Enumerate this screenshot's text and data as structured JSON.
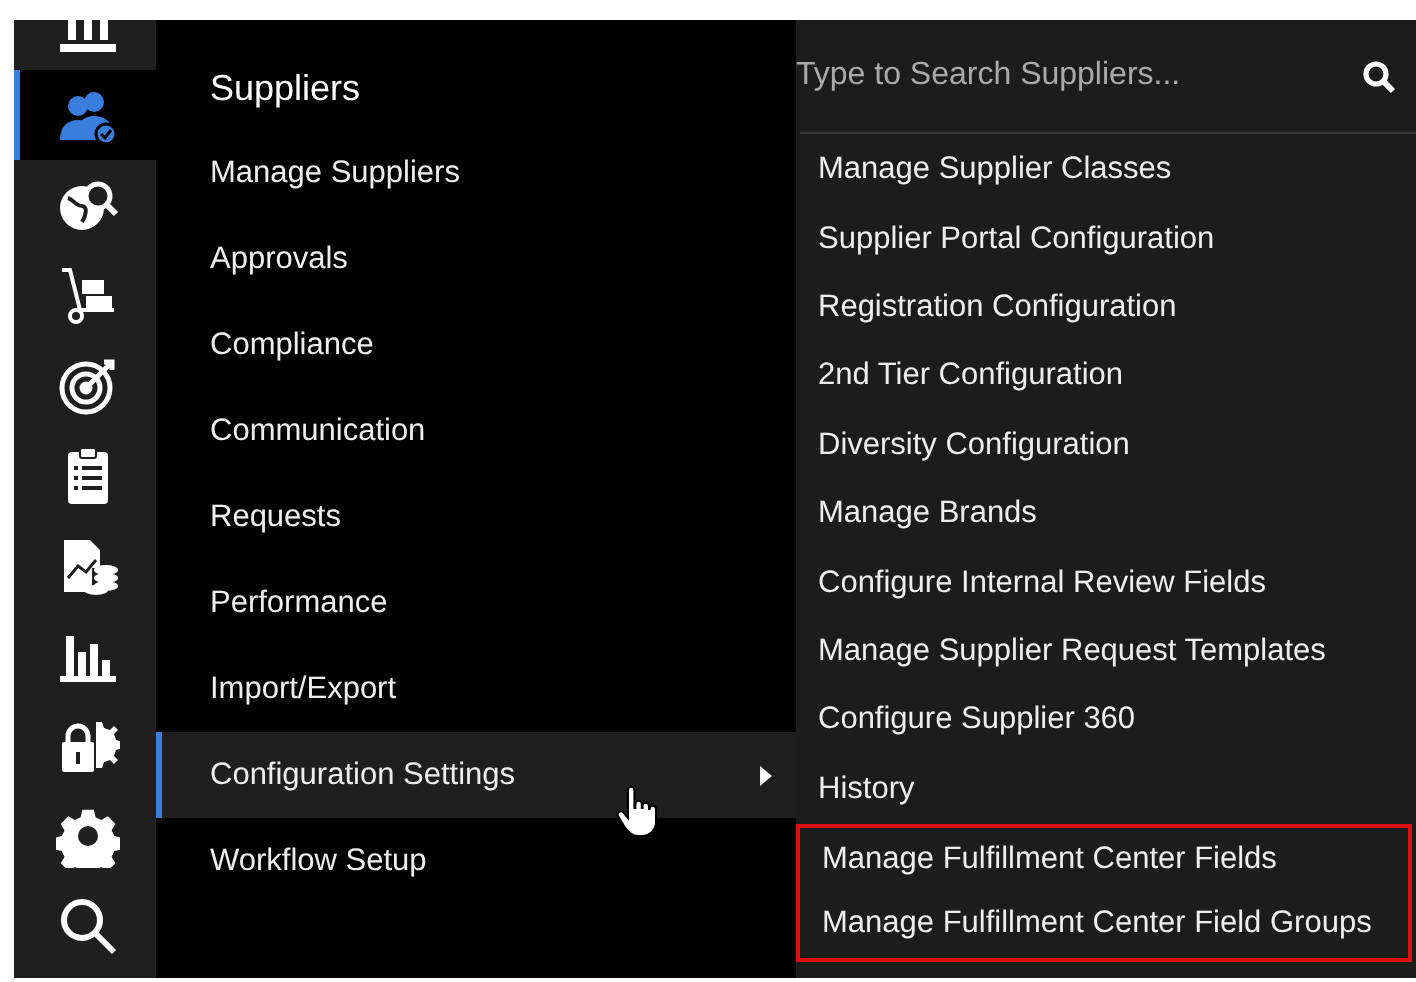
{
  "sidebar": {
    "items": [
      {
        "selected": false
      },
      {
        "selected": true
      },
      {
        "selected": false
      },
      {
        "selected": false
      },
      {
        "selected": false
      },
      {
        "selected": false
      },
      {
        "selected": false
      },
      {
        "selected": false
      },
      {
        "selected": false
      },
      {
        "selected": false
      },
      {
        "selected": false
      }
    ]
  },
  "menu": {
    "title": "Suppliers",
    "items": [
      {
        "label": "Manage Suppliers",
        "selected": false,
        "has_submenu": false
      },
      {
        "label": "Approvals",
        "selected": false,
        "has_submenu": false
      },
      {
        "label": "Compliance",
        "selected": false,
        "has_submenu": false
      },
      {
        "label": "Communication",
        "selected": false,
        "has_submenu": false
      },
      {
        "label": "Requests",
        "selected": false,
        "has_submenu": false
      },
      {
        "label": "Performance",
        "selected": false,
        "has_submenu": false
      },
      {
        "label": "Import/Export",
        "selected": false,
        "has_submenu": false
      },
      {
        "label": "Configuration Settings",
        "selected": true,
        "has_submenu": true
      },
      {
        "label": "Workflow Setup",
        "selected": false,
        "has_submenu": false
      }
    ]
  },
  "submenu": {
    "search": {
      "placeholder": "Type to Search Suppliers..."
    },
    "items": [
      {
        "label": "Manage Supplier Classes",
        "highlighted": false
      },
      {
        "label": "Supplier Portal Configuration",
        "highlighted": false
      },
      {
        "label": "Registration Configuration",
        "highlighted": false
      },
      {
        "label": "2nd Tier Configuration",
        "highlighted": false
      },
      {
        "label": "Diversity Configuration",
        "highlighted": false
      },
      {
        "label": "Manage Brands",
        "highlighted": false
      },
      {
        "label": "Configure Internal Review Fields",
        "highlighted": false
      },
      {
        "label": "Manage Supplier Request Templates",
        "highlighted": false
      },
      {
        "label": "Configure Supplier 360",
        "highlighted": false
      },
      {
        "label": "History",
        "highlighted": false
      },
      {
        "label": "Manage Fulfillment Center Fields",
        "highlighted": true
      },
      {
        "label": "Manage Fulfillment Center Field Groups",
        "highlighted": true
      }
    ]
  }
}
